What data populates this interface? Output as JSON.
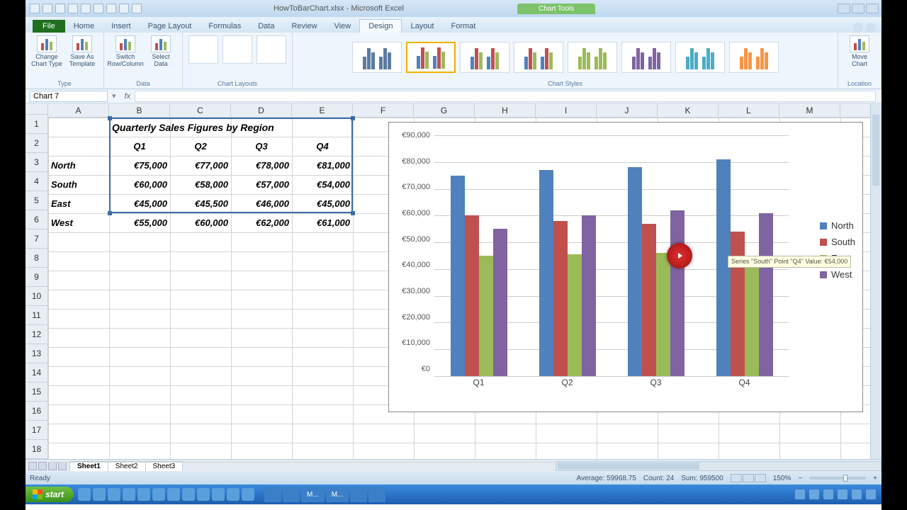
{
  "titlebar": {
    "document": "HowToBarChart.xlsx - Microsoft Excel",
    "context_tab": "Chart Tools"
  },
  "tabs": {
    "file": "File",
    "list": [
      "Home",
      "Insert",
      "Page Layout",
      "Formulas",
      "Data",
      "Review",
      "View"
    ],
    "chart_tools": [
      "Design",
      "Layout",
      "Format"
    ],
    "active": "Design"
  },
  "ribbon": {
    "type_group": "Type",
    "change_chart_type": "Change Chart Type",
    "save_template": "Save As Template",
    "data_group": "Data",
    "switch": "Switch Row/Column",
    "select": "Select Data",
    "layouts_group": "Chart Layouts",
    "styles_group": "Chart Styles",
    "location_group": "Location",
    "move_chart": "Move Chart"
  },
  "namebox": "Chart 7",
  "columns": [
    "A",
    "B",
    "C",
    "D",
    "E",
    "F",
    "G",
    "H",
    "I",
    "J",
    "K",
    "L",
    "M"
  ],
  "rows": [
    "1",
    "2",
    "3",
    "4",
    "5",
    "6",
    "7",
    "8",
    "9",
    "10",
    "11",
    "12",
    "13",
    "14",
    "15",
    "16",
    "17",
    "18"
  ],
  "table": {
    "title": "Quarterly Sales Figures by Region",
    "headers": [
      "Q1",
      "Q2",
      "Q3",
      "Q4"
    ],
    "regions": [
      "North",
      "South",
      "East",
      "West"
    ],
    "cells": [
      [
        "€75,000",
        "€77,000",
        "€78,000",
        "€81,000"
      ],
      [
        "€60,000",
        "€58,000",
        "€57,000",
        "€54,000"
      ],
      [
        "€45,000",
        "€45,500",
        "€46,000",
        "€45,000"
      ],
      [
        "€55,000",
        "€60,000",
        "€62,000",
        "€61,000"
      ]
    ]
  },
  "chart_data": {
    "type": "bar",
    "categories": [
      "Q1",
      "Q2",
      "Q3",
      "Q4"
    ],
    "series": [
      {
        "name": "North",
        "values": [
          75000,
          77000,
          78000,
          81000
        ],
        "color": "#4f81bd"
      },
      {
        "name": "South",
        "values": [
          60000,
          58000,
          57000,
          54000
        ],
        "color": "#c0504d"
      },
      {
        "name": "East",
        "values": [
          45000,
          45500,
          46000,
          45000
        ],
        "color": "#9bbb59"
      },
      {
        "name": "West",
        "values": [
          55000,
          60000,
          62000,
          61000
        ],
        "color": "#8064a2"
      }
    ],
    "ylim": [
      0,
      90000
    ],
    "yticks": [
      "€0",
      "€10,000",
      "€20,000",
      "€30,000",
      "€40,000",
      "€50,000",
      "€60,000",
      "€70,000",
      "€80,000",
      "€90,000"
    ],
    "legend_position": "right",
    "tooltip": "Series \"South\" Point \"Q4\"\nValue: €54,000"
  },
  "sheets": {
    "list": [
      "Sheet1",
      "Sheet2",
      "Sheet3"
    ],
    "active": "Sheet1"
  },
  "statusbar": {
    "ready": "Ready",
    "average": "Average: 59968.75",
    "count": "Count: 24",
    "sum": "Sum: 959500",
    "zoom": "150%"
  },
  "taskbar": {
    "start": "start",
    "apps": [
      "",
      "",
      "M...",
      "M...",
      "",
      ""
    ]
  }
}
